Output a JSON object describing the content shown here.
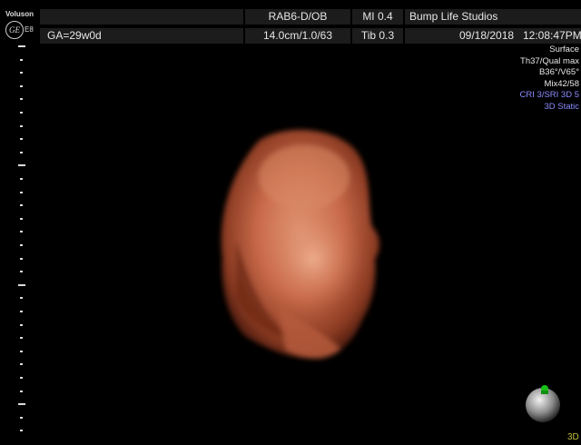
{
  "device": {
    "brand": "Voluson",
    "logo": "GE",
    "model": "E8"
  },
  "header": {
    "preset": "RAB6-D/OB",
    "mi": "MI  0.4",
    "studio": "Bump Life Studios",
    "ga": "GA=29w0d",
    "depth": "14.0cm/1.0/63",
    "tib": "Tib  0.3",
    "date": "09/18/2018",
    "time": "12:08:47PM"
  },
  "render_params": [
    {
      "text": "Surface",
      "highlight": false
    },
    {
      "text": "Th37/Qual max",
      "highlight": false
    },
    {
      "text": "B36°/V65°",
      "highlight": false
    },
    {
      "text": "Mix42/58",
      "highlight": false
    },
    {
      "text": "CRI 3/SRI 3D 5",
      "highlight": true
    },
    {
      "text": "3D Static",
      "highlight": true
    }
  ],
  "mode_tag": "3D",
  "colors": {
    "text": "#e8e8e8",
    "highlight": "#8b8bff",
    "header_bg": "#1c1c1c",
    "tissue": "#c96a4a"
  }
}
